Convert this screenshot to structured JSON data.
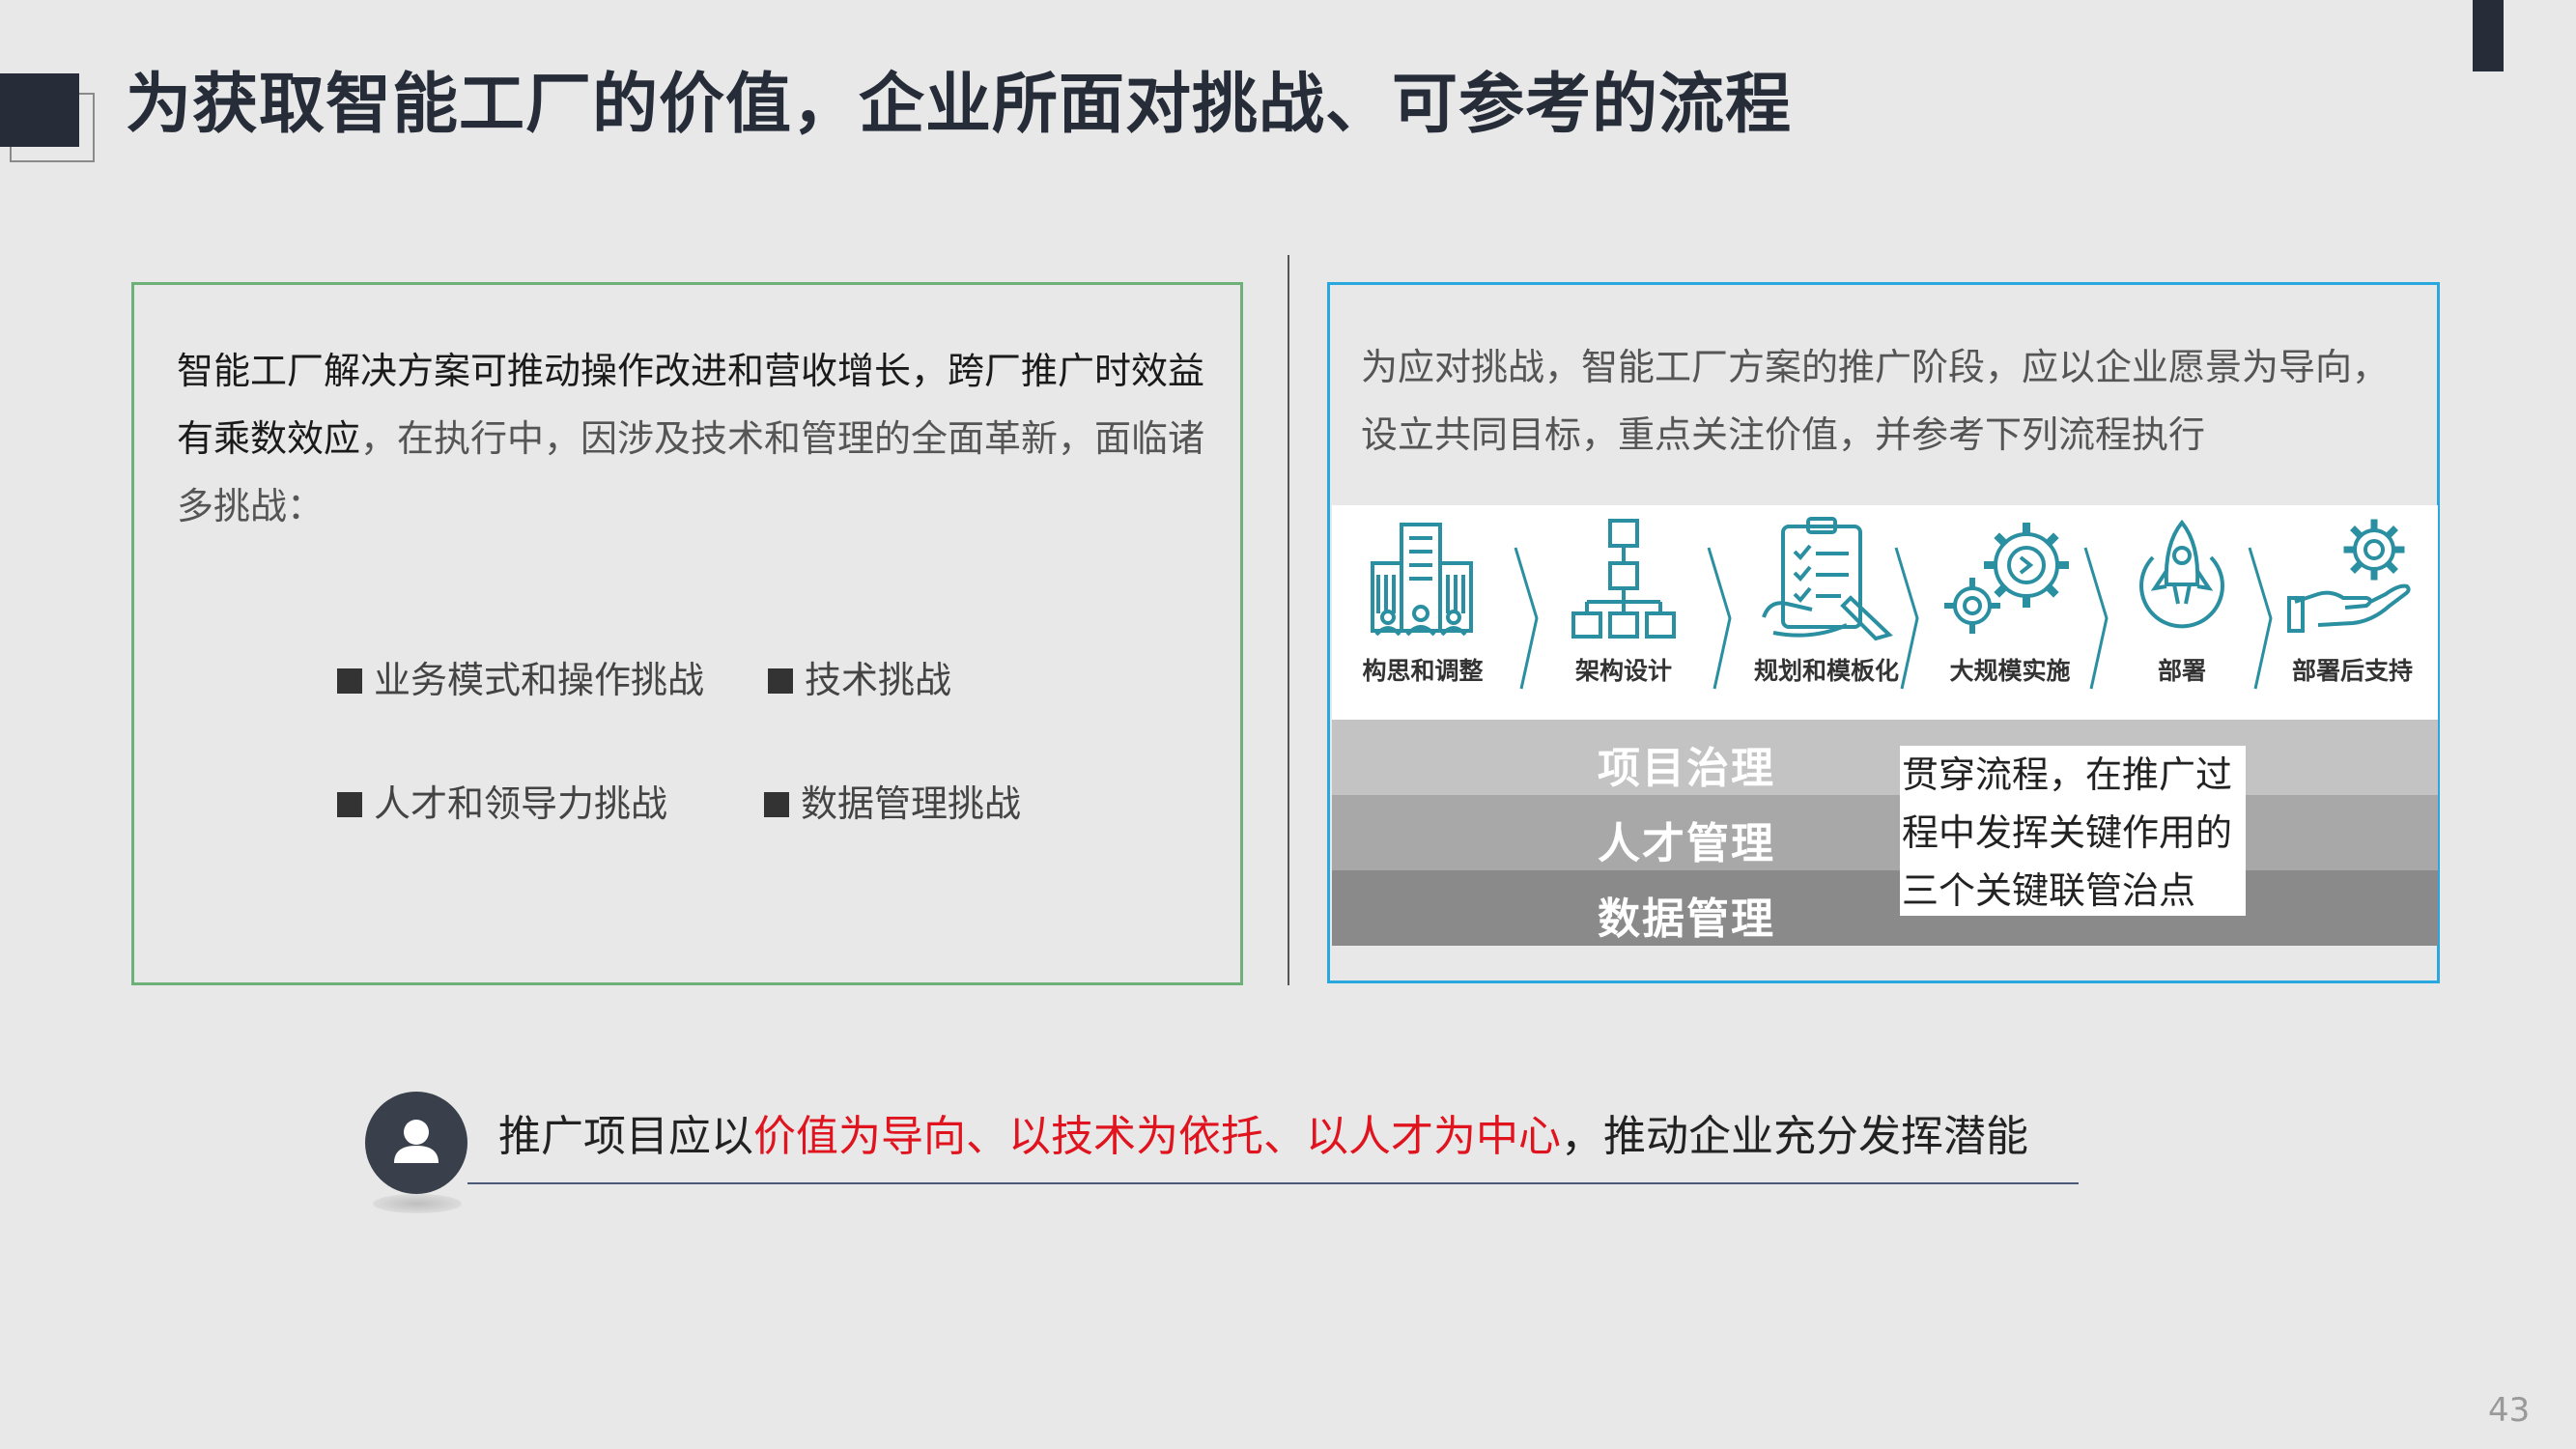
{
  "title": "为获取智能工厂的价值，企业所面对挑战、可参考的流程",
  "left_panel": {
    "intro_emph": "智能工厂解决方案可推动操作改进和营收增长，跨厂推广时效益有乘数效应",
    "intro_rest": "，在执行中，因涉及技术和管理的全面革新，面临诸多挑战：",
    "challenges": [
      "业务模式和操作挑战",
      "技术挑战",
      "人才和领导力挑战",
      "数据管理挑战"
    ]
  },
  "right_panel": {
    "intro": "为应对挑战，智能工厂方案的推广阶段，应以企业愿景为导向，设立共同目标，重点关注价值，并参考下列流程执行",
    "steps": [
      {
        "label": "构思和调整",
        "icon": "building-icon"
      },
      {
        "label": "架构设计",
        "icon": "hierarchy-icon"
      },
      {
        "label": "规划和模板化",
        "icon": "checklist-icon"
      },
      {
        "label": "大规模实施",
        "icon": "gears-icon"
      },
      {
        "label": "部署",
        "icon": "rocket-icon"
      },
      {
        "label": "部署后支持",
        "icon": "hand-gear-icon"
      }
    ],
    "bands": [
      "项目治理",
      "人才管理",
      "数据管理"
    ],
    "callout": "贯穿流程，在推广过程中发挥关键作用的三个关键联管治点"
  },
  "statement": {
    "prefix": "推广项目应以",
    "highlight": "价值为导向、以技术为依托、以人才为中心",
    "suffix": "，推动企业充分发挥潜能"
  },
  "page_number": "43",
  "colors": {
    "dark": "#262c38",
    "left_border": "#6db07a",
    "right_border": "#2aa7dc",
    "icon_teal": "#2a8fa0",
    "highlight_red": "#e0141e"
  }
}
